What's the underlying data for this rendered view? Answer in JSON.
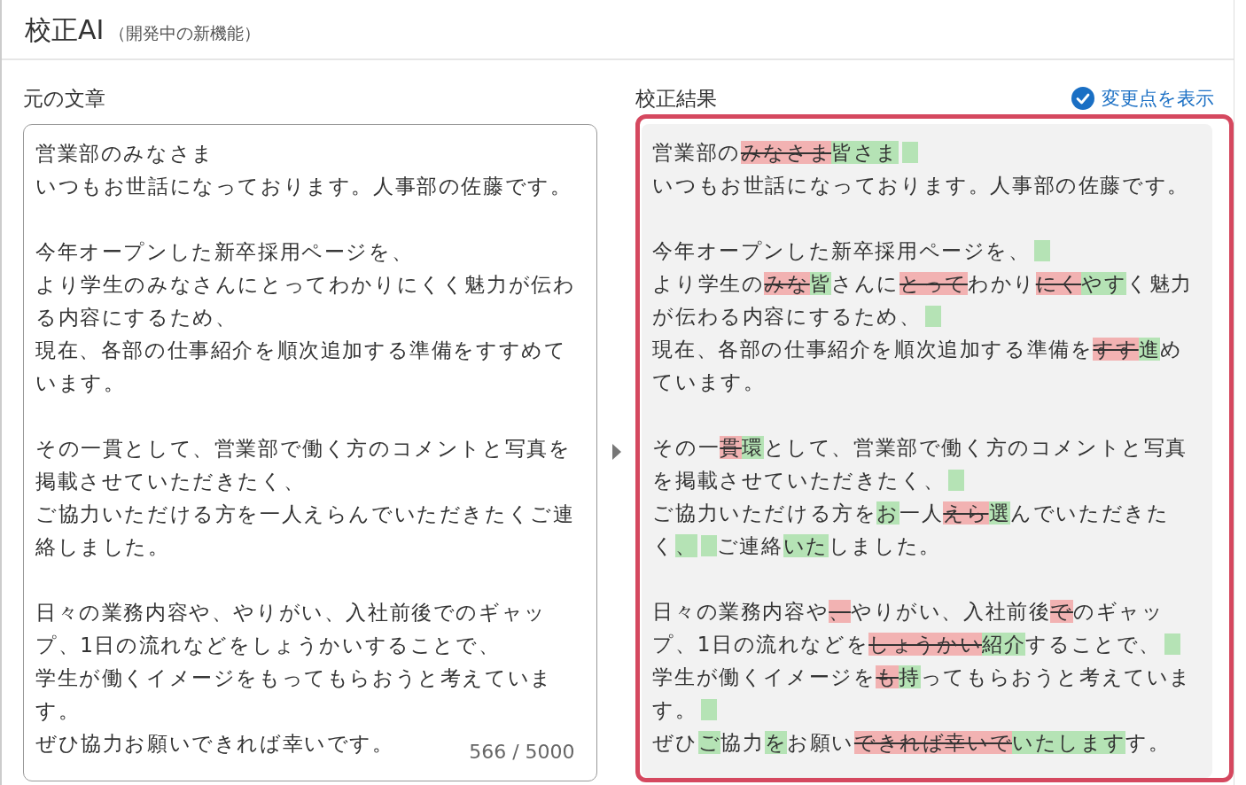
{
  "header": {
    "title": "校正AI",
    "subtitle": "（開発中の新機能）"
  },
  "original": {
    "label": "元の文章",
    "counter": "566 / 5000",
    "paragraphs": [
      [
        "営業部のみなさま",
        "いつもお世話になっております。人事部の佐藤です。"
      ],
      [
        "今年オープンした新卒採用ページを、",
        "より学生のみなさんにとってわかりにくく魅力が伝わ",
        "る内容にするため、",
        "現在、各部の仕事紹介を順次追加する準備をすすめて",
        "います。"
      ],
      [
        "その一貫として、営業部で働く方のコメントと写真を",
        "掲載させていただきたく、",
        "ご協力いただける方を一人えらんでいただきたくご連",
        "絡しました。"
      ],
      [
        "日々の業務内容や、やりがい、入社前後でのギャッ",
        "プ、1日の流れなどをしょうかいすることで、",
        "学生が働くイメージをもってもらおうと考えていま",
        "す。",
        "ぜひ協力お願いできれば幸いです。"
      ]
    ]
  },
  "result": {
    "label": "校正結果",
    "show_changes": {
      "label": "変更点を表示",
      "checked": true
    },
    "paragraphs": [
      [
        [
          {
            "kind": "same",
            "text": "営業部の"
          },
          {
            "kind": "del",
            "text": "みなさま"
          },
          {
            "kind": "add",
            "text": "皆さま"
          },
          {
            "kind": "gap"
          }
        ],
        [
          {
            "kind": "same",
            "text": "いつもお世話になっております。人事部の佐藤です。"
          }
        ]
      ],
      [
        [
          {
            "kind": "same",
            "text": "今年オープンした新卒採用ページを、"
          },
          {
            "kind": "gap"
          }
        ],
        [
          {
            "kind": "same",
            "text": "より学生の"
          },
          {
            "kind": "del",
            "text": "みな"
          },
          {
            "kind": "add",
            "text": "皆"
          },
          {
            "kind": "same",
            "text": "さんに"
          },
          {
            "kind": "del",
            "text": "とって"
          },
          {
            "kind": "same",
            "text": "わかり"
          },
          {
            "kind": "del",
            "text": "にく"
          },
          {
            "kind": "add",
            "text": "やす"
          },
          {
            "kind": "same",
            "text": "く魅力"
          }
        ],
        [
          {
            "kind": "same",
            "text": "が伝わる内容にするため、"
          },
          {
            "kind": "gap"
          }
        ],
        [
          {
            "kind": "same",
            "text": "現在、各部の仕事紹介を順次追加する準備を"
          },
          {
            "kind": "del",
            "text": "すす"
          },
          {
            "kind": "add",
            "text": "進"
          },
          {
            "kind": "same",
            "text": "め"
          }
        ],
        [
          {
            "kind": "same",
            "text": "ています。"
          }
        ]
      ],
      [
        [
          {
            "kind": "same",
            "text": "その一"
          },
          {
            "kind": "del",
            "text": "貫"
          },
          {
            "kind": "add",
            "text": "環"
          },
          {
            "kind": "same",
            "text": "として、営業部で働く方のコメントと写真"
          }
        ],
        [
          {
            "kind": "same",
            "text": "を掲載させていただきたく、"
          },
          {
            "kind": "gap"
          }
        ],
        [
          {
            "kind": "same",
            "text": "ご協力いただける方を"
          },
          {
            "kind": "add",
            "text": "お"
          },
          {
            "kind": "same",
            "text": "一人"
          },
          {
            "kind": "del",
            "text": "えら"
          },
          {
            "kind": "add",
            "text": "選"
          },
          {
            "kind": "same",
            "text": "んでいただきた"
          }
        ],
        [
          {
            "kind": "same",
            "text": "く"
          },
          {
            "kind": "add",
            "text": "、"
          },
          {
            "kind": "gap"
          },
          {
            "kind": "same",
            "text": "ご連絡"
          },
          {
            "kind": "add",
            "text": "いた"
          },
          {
            "kind": "same",
            "text": "しました。"
          }
        ]
      ],
      [
        [
          {
            "kind": "same",
            "text": "日々の業務内容や"
          },
          {
            "kind": "del",
            "text": "、"
          },
          {
            "kind": "same",
            "text": "やりがい、入社前後"
          },
          {
            "kind": "del",
            "text": "で"
          },
          {
            "kind": "same",
            "text": "のギャッ"
          }
        ],
        [
          {
            "kind": "same",
            "text": "プ、1日の流れなどを"
          },
          {
            "kind": "del",
            "text": "しょうかい"
          },
          {
            "kind": "add",
            "text": "紹介"
          },
          {
            "kind": "same",
            "text": "することで、"
          },
          {
            "kind": "gap"
          }
        ],
        [
          {
            "kind": "same",
            "text": "学生が働くイメージを"
          },
          {
            "kind": "del",
            "text": "も"
          },
          {
            "kind": "add",
            "text": "持"
          },
          {
            "kind": "same",
            "text": "ってもらおうと考えていま"
          }
        ],
        [
          {
            "kind": "same",
            "text": "す。"
          },
          {
            "kind": "gap"
          }
        ],
        [
          {
            "kind": "same",
            "text": "ぜひ"
          },
          {
            "kind": "add",
            "text": "ご"
          },
          {
            "kind": "same",
            "text": "協力"
          },
          {
            "kind": "add",
            "text": "を"
          },
          {
            "kind": "same",
            "text": "お願い"
          },
          {
            "kind": "del",
            "text": "できれば幸いで"
          },
          {
            "kind": "add",
            "text": "いたします"
          },
          {
            "kind": "same",
            "text": "す。"
          }
        ]
      ]
    ]
  }
}
